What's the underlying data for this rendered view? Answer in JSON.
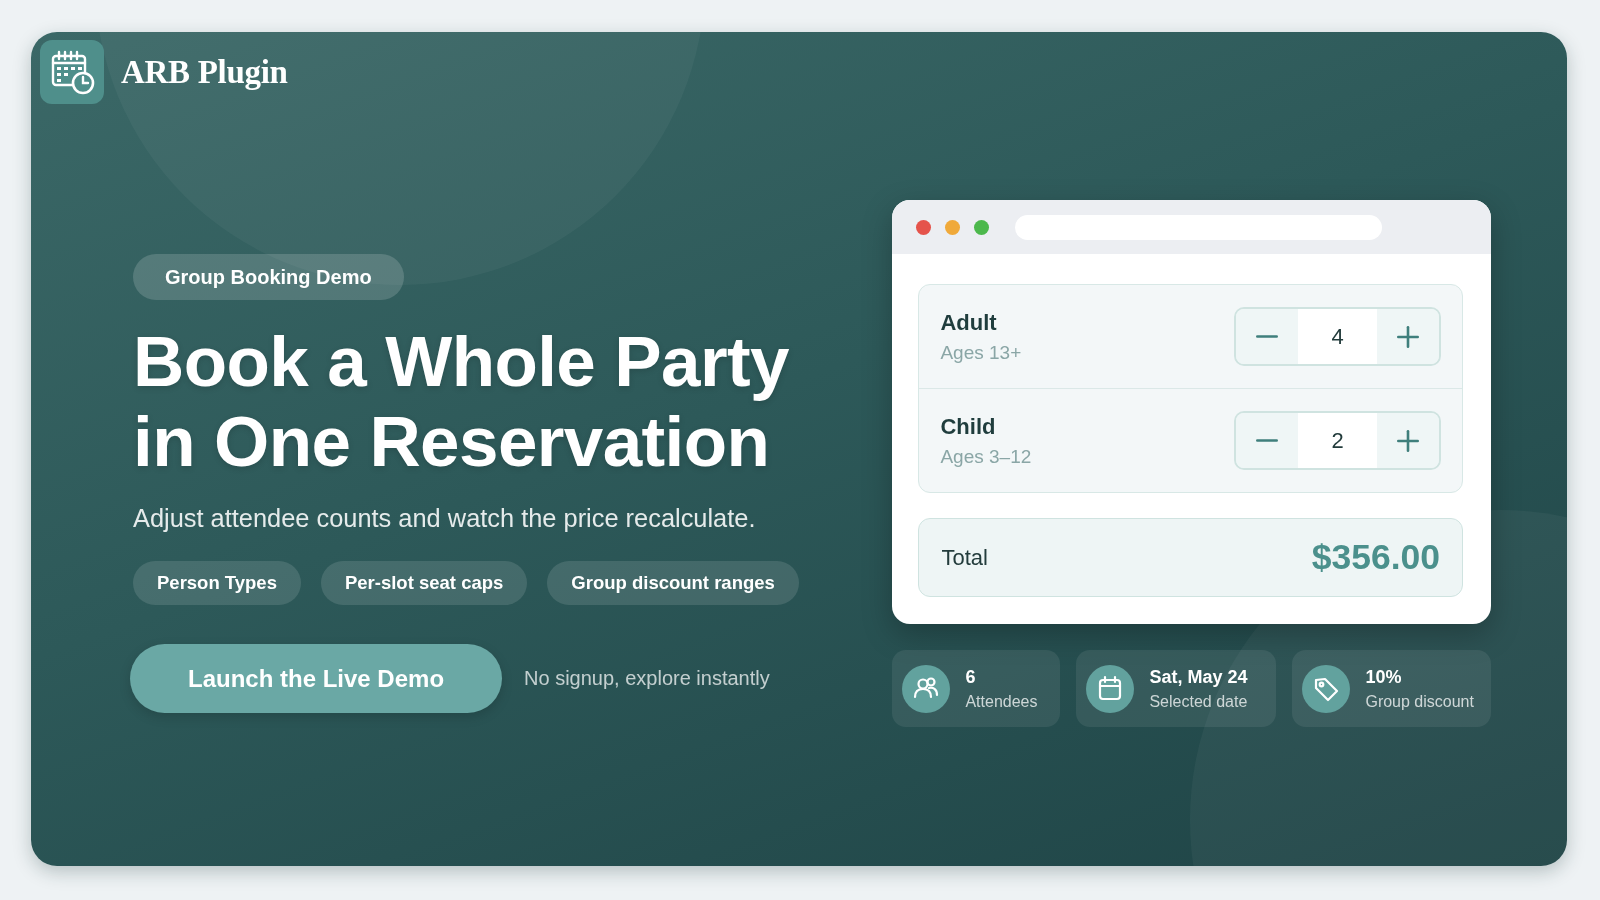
{
  "brand": {
    "name": "ARB Plugin"
  },
  "hero": {
    "badge": "Group Booking Demo",
    "title_lines": [
      "Book a Whole Party",
      "in One Reservation"
    ],
    "subtitle": "Adjust attendee counts and watch the price recalculate.",
    "features": [
      "Person Types",
      "Per-slot seat caps",
      "Group discount ranges"
    ],
    "cta": {
      "label": "Launch the Live Demo"
    },
    "cta_note": "No signup, explore instantly"
  },
  "preview": {
    "window_dots": [
      {
        "color": "#e5534b"
      },
      {
        "color": "#f0a93a"
      },
      {
        "color": "#4cb84c"
      }
    ],
    "person_types": [
      {
        "name": "Adult",
        "ages": "Ages 13+",
        "count": "4"
      },
      {
        "name": "Child",
        "ages": "Ages 3–12",
        "count": "2"
      }
    ],
    "total": {
      "label": "Total",
      "amount": "$356.00"
    }
  },
  "stats": [
    {
      "kind": "attendees",
      "value": "6",
      "label": "Attendees"
    },
    {
      "kind": "date",
      "value": "Sat, May 24",
      "label": "Selected date"
    },
    {
      "kind": "discount",
      "value": "10%",
      "label": "Group discount"
    }
  ]
}
